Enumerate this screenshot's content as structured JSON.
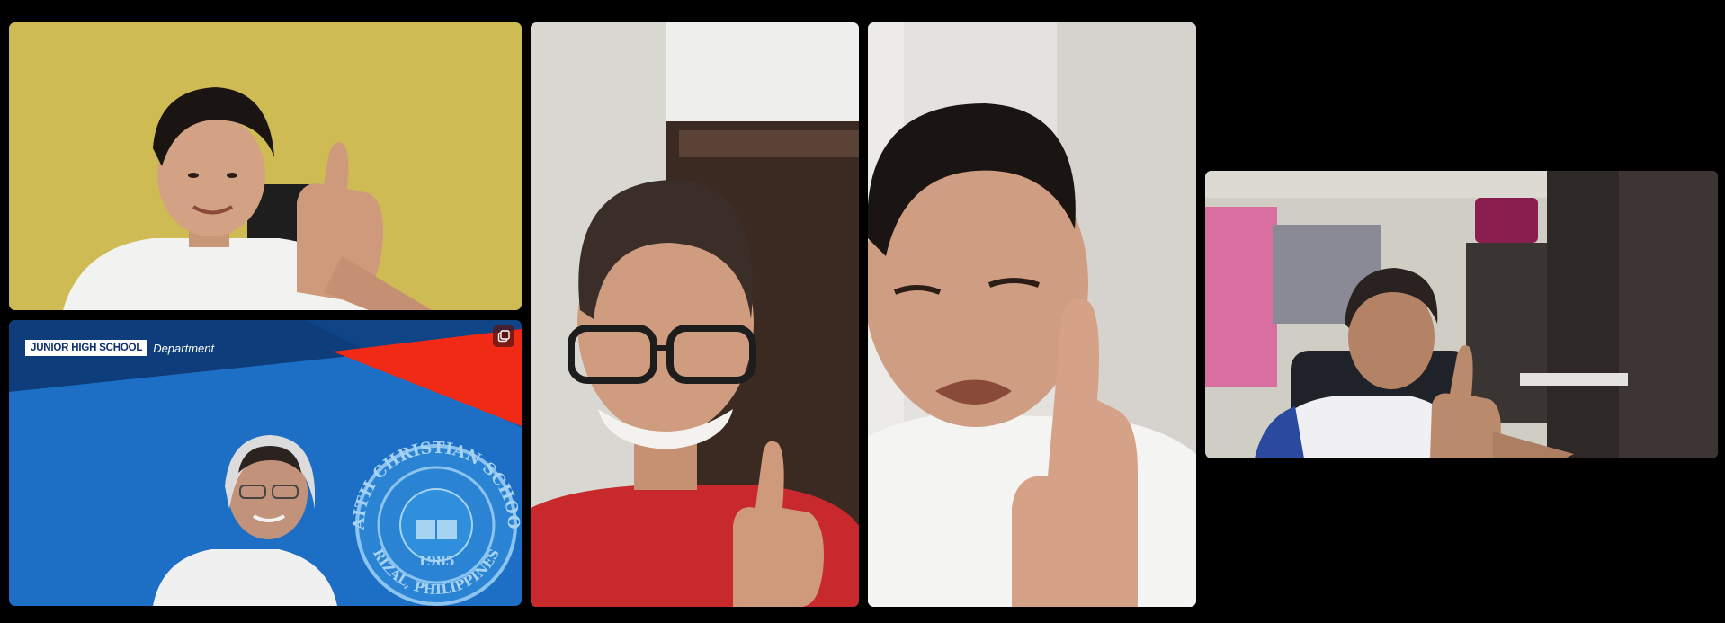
{
  "participants": [
    {
      "id": "p1",
      "background": "yellow-wall",
      "gesture": "thumbs-up"
    },
    {
      "id": "p2",
      "background": "virtual-background",
      "gesture": "none"
    },
    {
      "id": "p3",
      "background": "doorway",
      "gesture": "thumbs-up",
      "active_speaker": true
    },
    {
      "id": "p4",
      "background": "white-wall",
      "gesture": "thumbs-up"
    },
    {
      "id": "p5",
      "background": "bedroom",
      "gesture": "thumbs-up"
    }
  ],
  "virtual_background": {
    "banner_bold": "JUNIOR HIGH SCHOOL",
    "banner_italic": "Department",
    "seal_top_text": "FAITH CHRISTIAN SCHOOL",
    "seal_bottom_text": "RIZAL, PHILIPPINES",
    "seal_year": "1985",
    "colors": {
      "blue": "#1c6fc4",
      "dark_blue": "#0d3d7a",
      "red": "#f02a14"
    }
  },
  "icons": {
    "popout": "popout-icon"
  },
  "colors": {
    "active_border": "#ffffff",
    "canvas": "#000000"
  }
}
